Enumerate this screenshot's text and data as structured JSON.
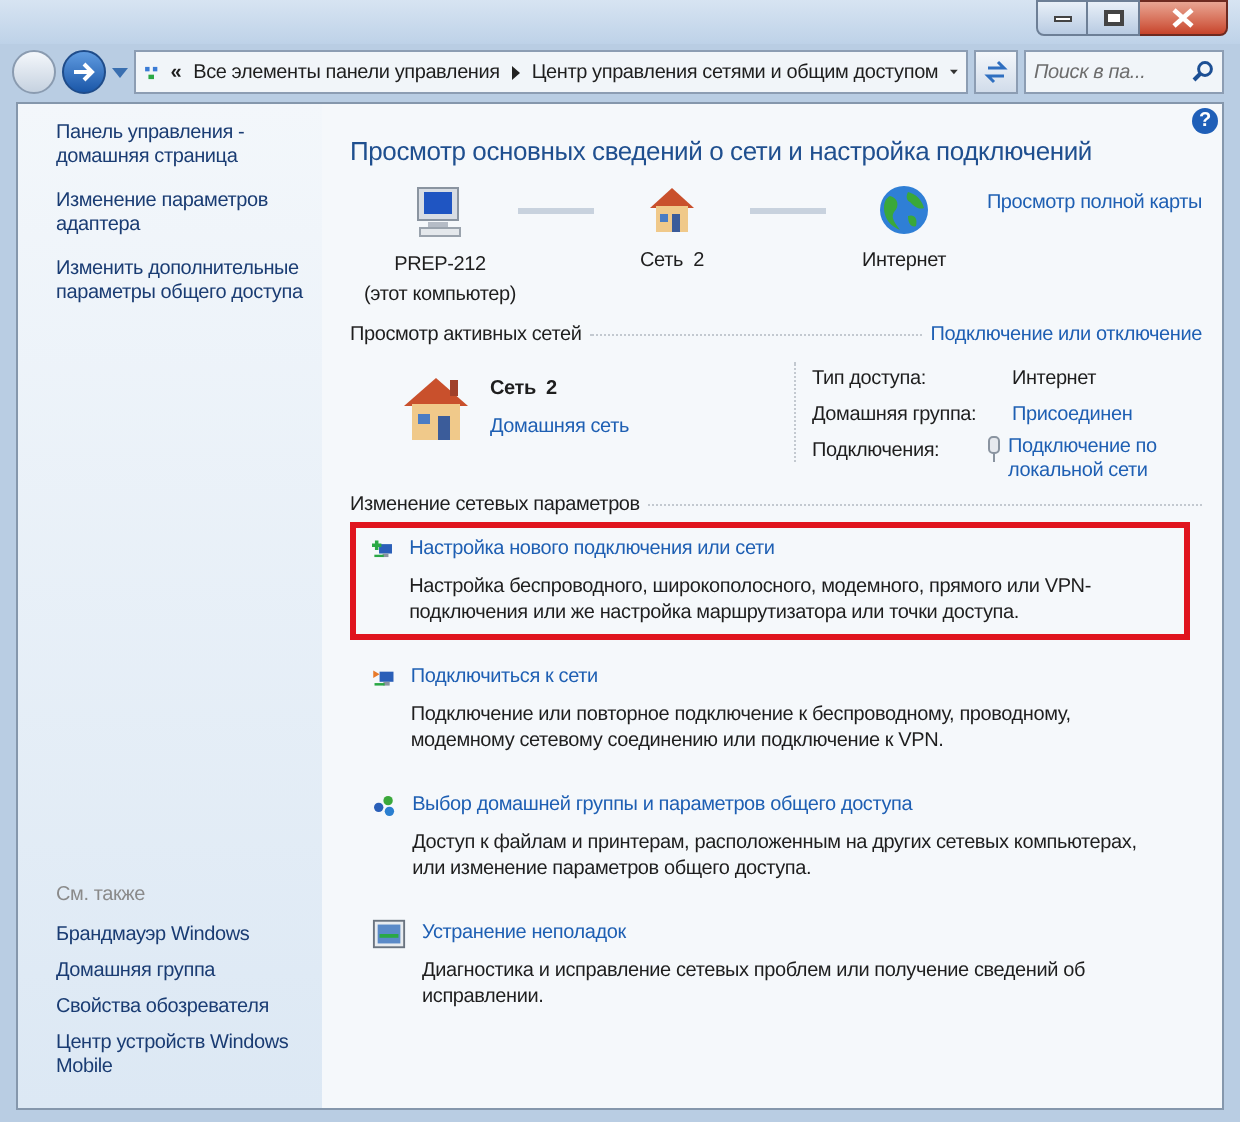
{
  "address_bar": {
    "overflow": "«",
    "breadcrumbs": [
      "Все элементы панели управления",
      "Центр управления сетями и общим доступом"
    ]
  },
  "search": {
    "placeholder": "Поиск в па..."
  },
  "help_button": "?",
  "sidebar": {
    "links": [
      "Панель управления - домашняя страница",
      "Изменение параметров адаптера",
      "Изменить дополнительные параметры общего доступа"
    ],
    "see_also_heading": "См. также",
    "see_also": [
      "Брандмауэр Windows",
      "Домашняя группа",
      "Свойства обозревателя",
      "Центр устройств Windows Mobile"
    ]
  },
  "main": {
    "title": "Просмотр основных сведений о сети и настройка подключений",
    "map": [
      {
        "kind": "computer",
        "label": "PREP-212",
        "sublabel": "(этот компьютер)"
      },
      {
        "kind": "house",
        "label": "Сеть  2"
      },
      {
        "kind": "globe",
        "label": "Интернет"
      }
    ],
    "full_map_link": "Просмотр полной карты",
    "active_heading": "Просмотр активных сетей",
    "connect_link": "Подключение или отключение",
    "network": {
      "name": "Сеть  2",
      "type": "Домашняя сеть"
    },
    "details": [
      {
        "label": "Тип доступа:",
        "value": "Интернет",
        "kind": "text"
      },
      {
        "label": "Домашняя группа:",
        "value": "Присоединен",
        "kind": "link"
      },
      {
        "label": "Подключения:",
        "value": "Подключение по локальной сети",
        "kind": "plug-link"
      }
    ],
    "change_heading": "Изменение сетевых параметров",
    "tasks": [
      {
        "kind": "new",
        "title": "Настройка нового подключения или сети",
        "description": "Настройка беспроводного, широкополосного, модемного, прямого или VPN-подключения или же настройка маршрутизатора или точки доступа.",
        "highlighted": true
      },
      {
        "kind": "connect",
        "title": "Подключиться к сети",
        "description": "Подключение или повторное подключение к беспроводному, проводному, модемному сетевому соединению или подключение к VPN.",
        "highlighted": false
      },
      {
        "kind": "homegroup",
        "title": "Выбор домашней группы и параметров общего доступа",
        "description": "Доступ к файлам и принтерам, расположенным на других сетевых компьютерах, или изменение параметров общего доступа.",
        "highlighted": false
      },
      {
        "kind": "troubleshoot",
        "title": "Устранение неполадок",
        "description": "Диагностика и исправление сетевых проблем или получение сведений об исправлении.",
        "highlighted": false
      }
    ]
  }
}
